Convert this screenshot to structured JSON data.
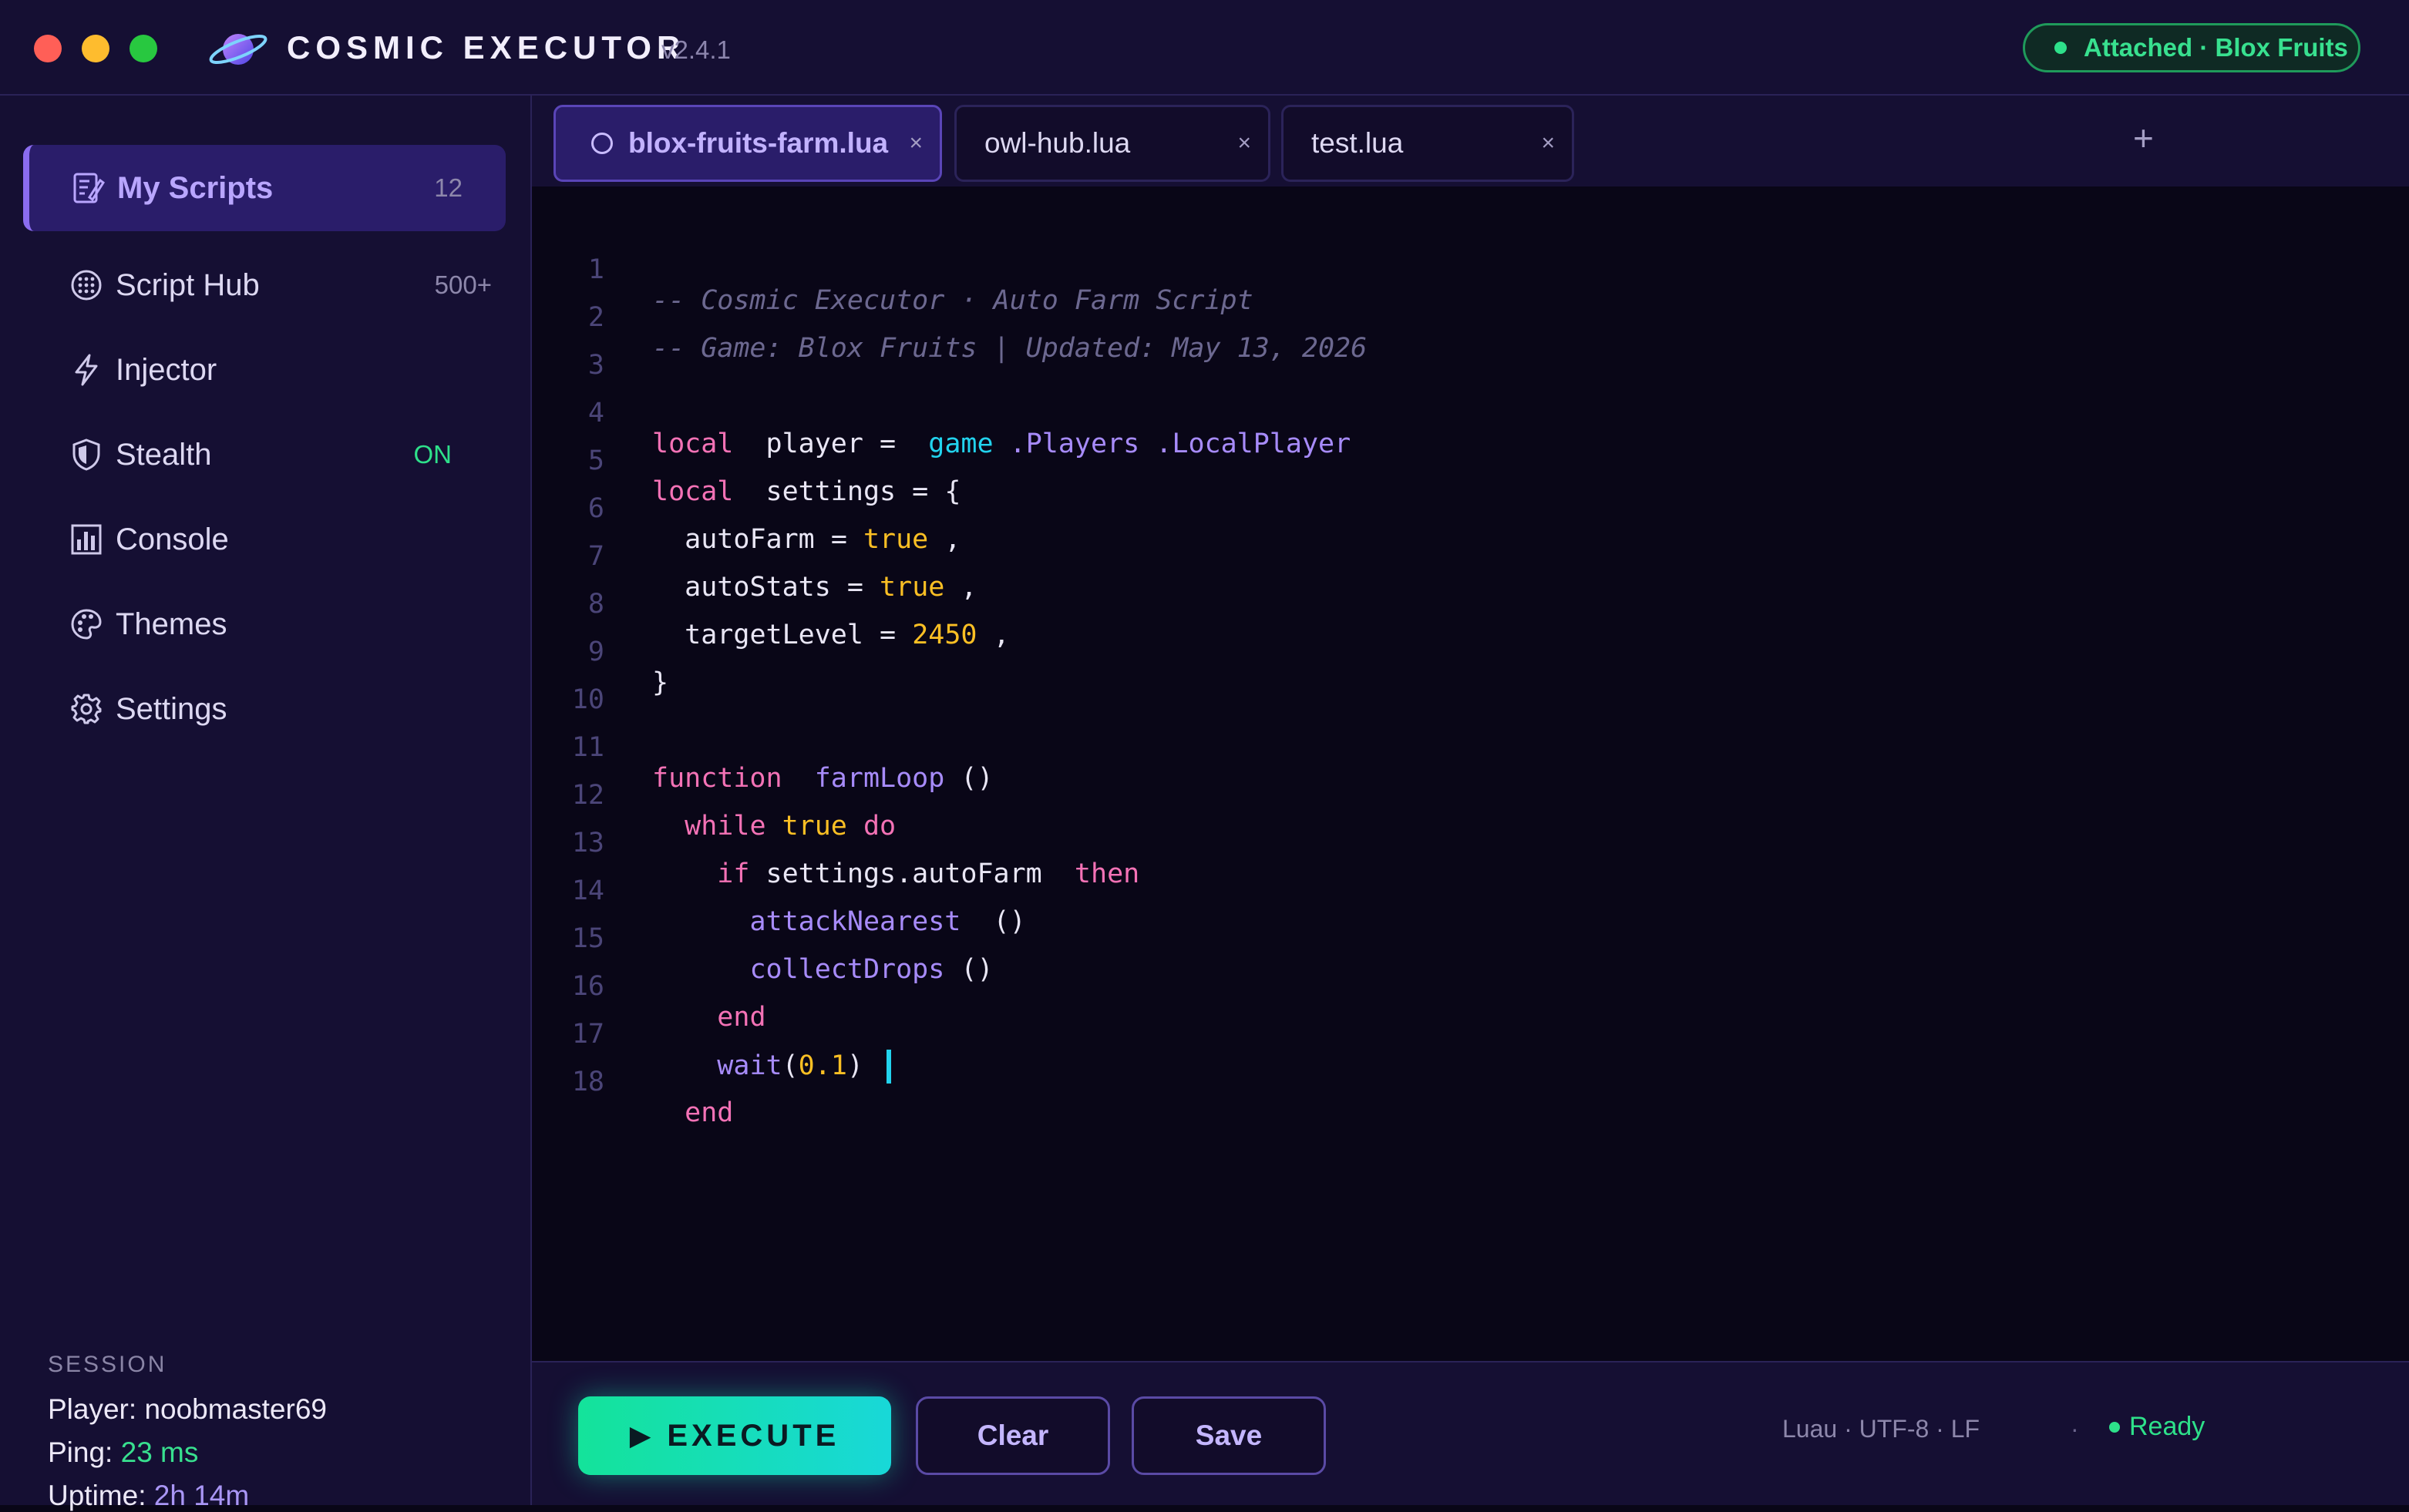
{
  "window": {
    "title": "COSMIC EXECUTOR",
    "version": "v2.4.1",
    "attached_status": "Attached · Blox Fruits"
  },
  "sidebar": {
    "items": [
      {
        "label": "My Scripts",
        "count": "12",
        "icon": "script-edit-icon",
        "active": true
      },
      {
        "label": "Script Hub",
        "count": "500+",
        "icon": "globe-grid-icon"
      },
      {
        "label": "Injector",
        "count": "",
        "icon": "lightning-icon"
      },
      {
        "label": "Stealth",
        "count": "ON",
        "icon": "shield-icon"
      },
      {
        "label": "Console",
        "count": "",
        "icon": "bar-chart-icon"
      },
      {
        "label": "Themes",
        "count": "",
        "icon": "palette-icon"
      },
      {
        "label": "Settings",
        "count": "",
        "icon": "gear-icon"
      }
    ],
    "session": {
      "heading": "SESSION",
      "player_label": "Player:",
      "player_value": "noobmaster69",
      "ping_label": "Ping:",
      "ping_value": "23 ms",
      "uptime_label": "Uptime:",
      "uptime_value": "2h 14m"
    }
  },
  "tabs": [
    {
      "name": "blox-fruits-farm.lua",
      "close": "×",
      "active": true
    },
    {
      "name": "owl-hub.lua",
      "close": "×"
    },
    {
      "name": "test.lua",
      "close": "×"
    }
  ],
  "tab_add": "+",
  "editor": {
    "line_numbers": [
      "1",
      "2",
      "3",
      "4",
      "5",
      "6",
      "7",
      "8",
      "9",
      "10",
      "11",
      "12",
      "13",
      "14",
      "15",
      "16",
      "17",
      "18"
    ],
    "l1": "-- Cosmic Executor · Auto Farm Script",
    "l2": "-- Game: Blox Fruits | Updated: May 13, 2026",
    "kw_local": "local",
    "kw_function": "function",
    "kw_while": "while",
    "kw_do": "do",
    "kw_if": "if",
    "kw_then": "then",
    "kw_end": "end",
    "kw_true": "true",
    "id_player": "player",
    "eq": "=",
    "glob_game": "game",
    "prop_players": ".Players",
    "prop_localplayer": ".LocalPlayer",
    "id_settings": "settings",
    "brace_open": "{",
    "brace_close": "}",
    "comma": ",",
    "id_autofarm": "autoFarm",
    "id_autostats": "autoStats",
    "id_targetlevel": "targetLevel",
    "num_level": "2450",
    "fn_farmloop": "farmLoop",
    "parens": "()",
    "expr_settings_autofarm": "settings.autoFarm",
    "fn_attack": "attackNearest",
    "fn_collect": "collectDrops",
    "fn_wait": "wait",
    "paren_open": "(",
    "paren_close": ")",
    "num_wait": "0.1"
  },
  "actions": {
    "execute_icon": "▶",
    "execute_label": "EXECUTE",
    "clear_label": "Clear",
    "save_label": "Save"
  },
  "status": {
    "meta": "Luau · UTF-8 · LF",
    "separator": "·",
    "state": "Ready"
  },
  "colors": {
    "accent": "#8b6cf0",
    "success": "#2ee08a",
    "keyword": "#f472b6",
    "function": "#a78bfa",
    "number": "#fbbf24",
    "global": "#22d3ee"
  }
}
